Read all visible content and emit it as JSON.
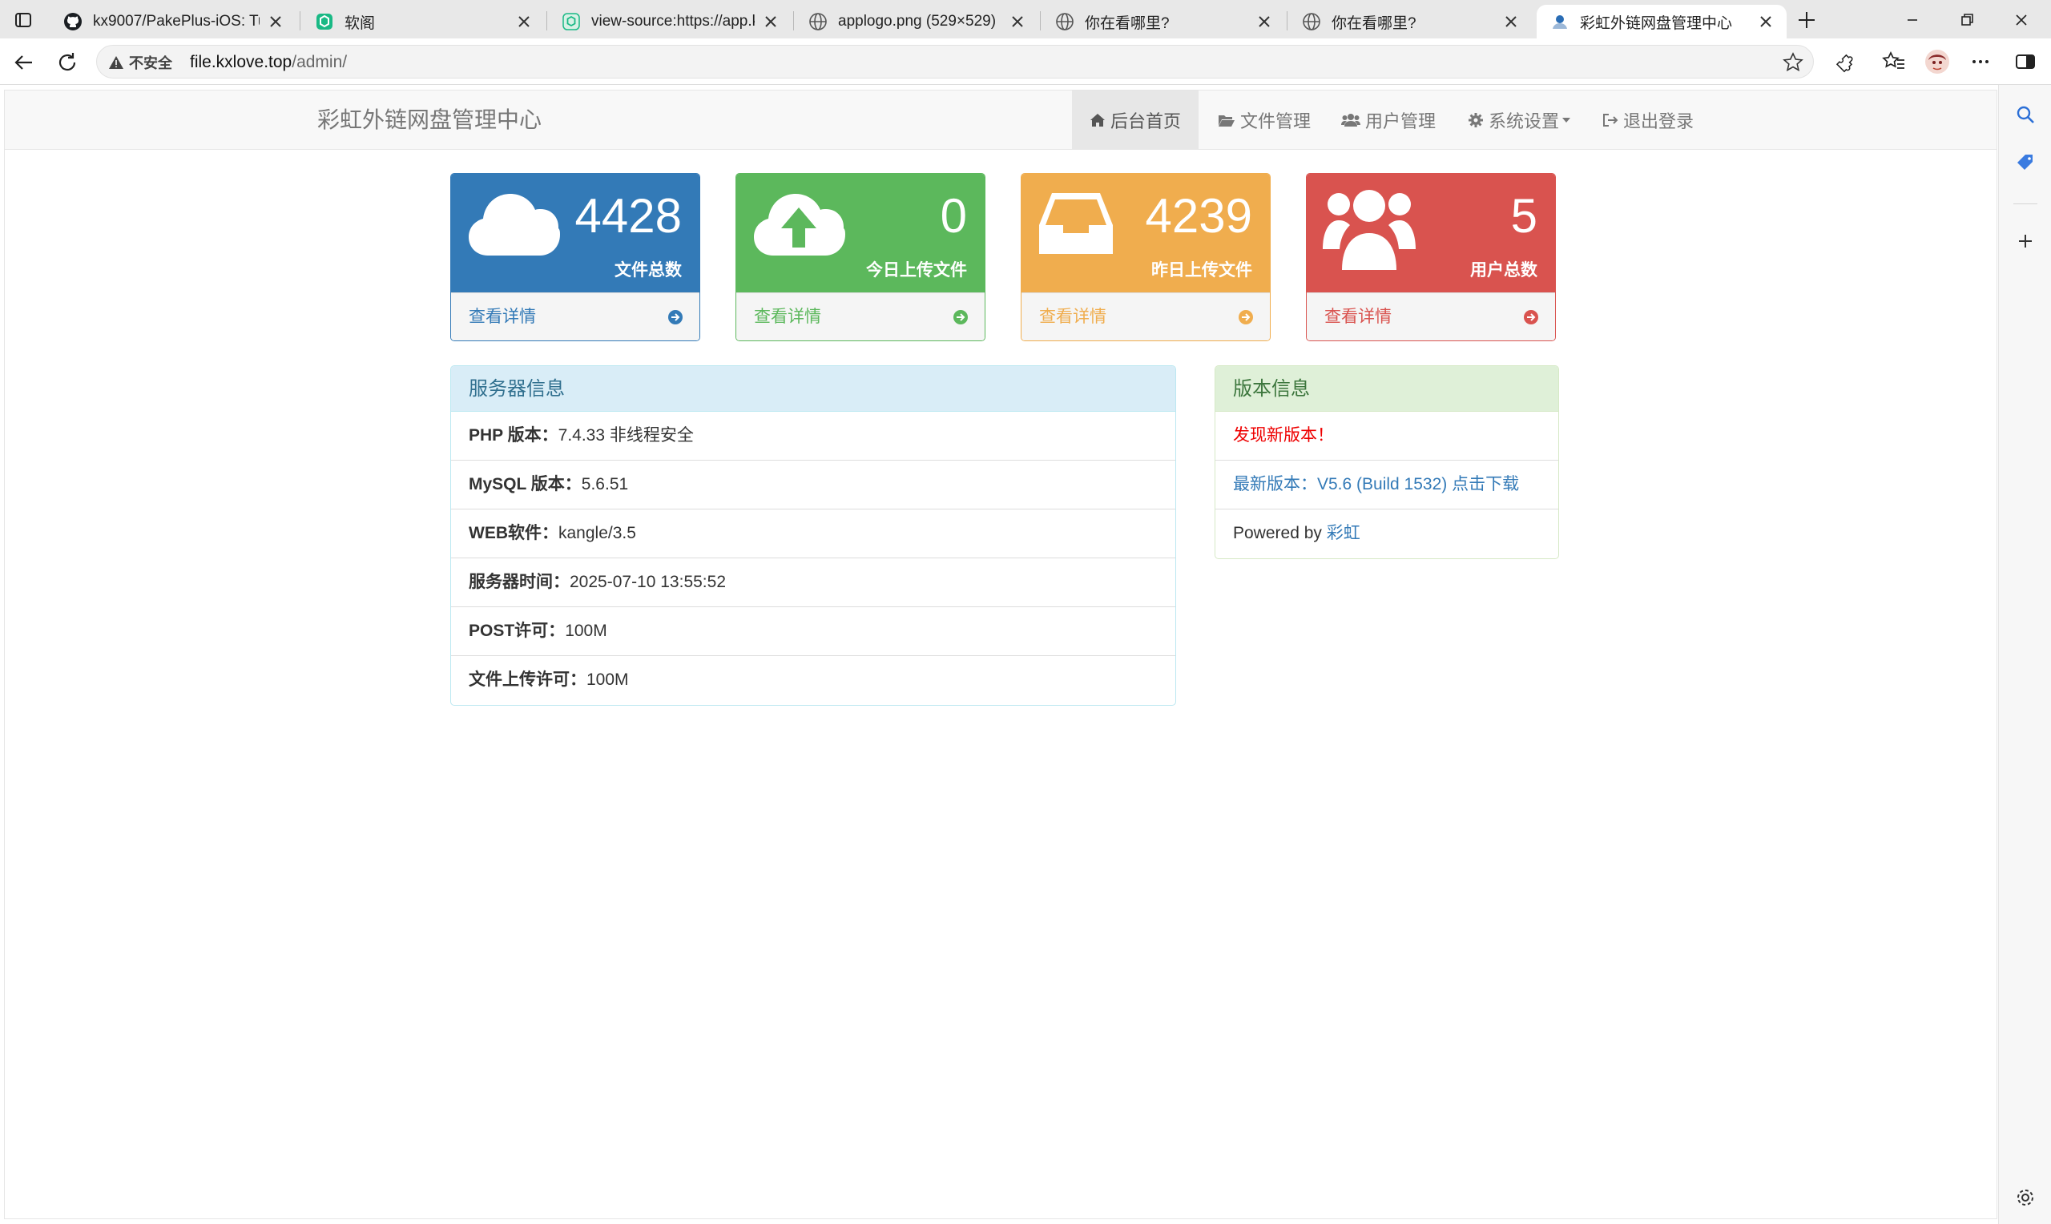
{
  "browser": {
    "tabs": [
      {
        "title": "kx9007/PakePlus-iOS: Turn",
        "icon": "github-icon"
      },
      {
        "title": "软阁",
        "icon": "app-green-icon"
      },
      {
        "title": "view-source:https://app.kxl",
        "icon": "app-green-icon"
      },
      {
        "title": "applogo.png (529×529)",
        "icon": "globe-icon"
      },
      {
        "title": "你在看哪里?",
        "icon": "globe-icon"
      },
      {
        "title": "你在看哪里?",
        "icon": "globe-icon"
      },
      {
        "title": "彩虹外链网盘管理中心",
        "icon": "user-favicon-icon"
      }
    ],
    "security_label": "不安全",
    "url_host": "file.kxlove.top",
    "url_path": "/admin/"
  },
  "navbar": {
    "brand": "彩虹外链网盘管理中心",
    "items": [
      {
        "label": "后台首页",
        "icon": "home-icon"
      },
      {
        "label": "文件管理",
        "icon": "folder-open-icon"
      },
      {
        "label": "用户管理",
        "icon": "users-icon"
      },
      {
        "label": "系统设置",
        "icon": "cog-icon"
      },
      {
        "label": "退出登录",
        "icon": "sign-out-icon"
      }
    ]
  },
  "stats": [
    {
      "value": "4428",
      "label": "文件总数",
      "more": "查看详情",
      "color": "#337ab7"
    },
    {
      "value": "0",
      "label": "今日上传文件",
      "more": "查看详情",
      "color": "#5cb85c"
    },
    {
      "value": "4239",
      "label": "昨日上传文件",
      "more": "查看详情",
      "color": "#f0ad4e"
    },
    {
      "value": "5",
      "label": "用户总数",
      "more": "查看详情",
      "color": "#d9534f"
    }
  ],
  "server_info": {
    "title": "服务器信息",
    "rows": [
      {
        "label": "PHP 版本：",
        "value": "7.4.33 非线程安全"
      },
      {
        "label": "MySQL 版本：",
        "value": "5.6.51"
      },
      {
        "label": "WEB软件：",
        "value": "kangle/3.5"
      },
      {
        "label": "服务器时间：",
        "value": "2025-07-10 13:55:52"
      },
      {
        "label": "POST许可：",
        "value": "100M"
      },
      {
        "label": "文件上传许可：",
        "value": "100M"
      }
    ]
  },
  "version_info": {
    "title": "版本信息",
    "new_version_notice": "发现新版本！",
    "latest_prefix": "最新版本：",
    "latest_link": "V5.6 (Build 1532) 点击下载",
    "powered_prefix": "Powered by ",
    "powered_link": "彩虹"
  }
}
